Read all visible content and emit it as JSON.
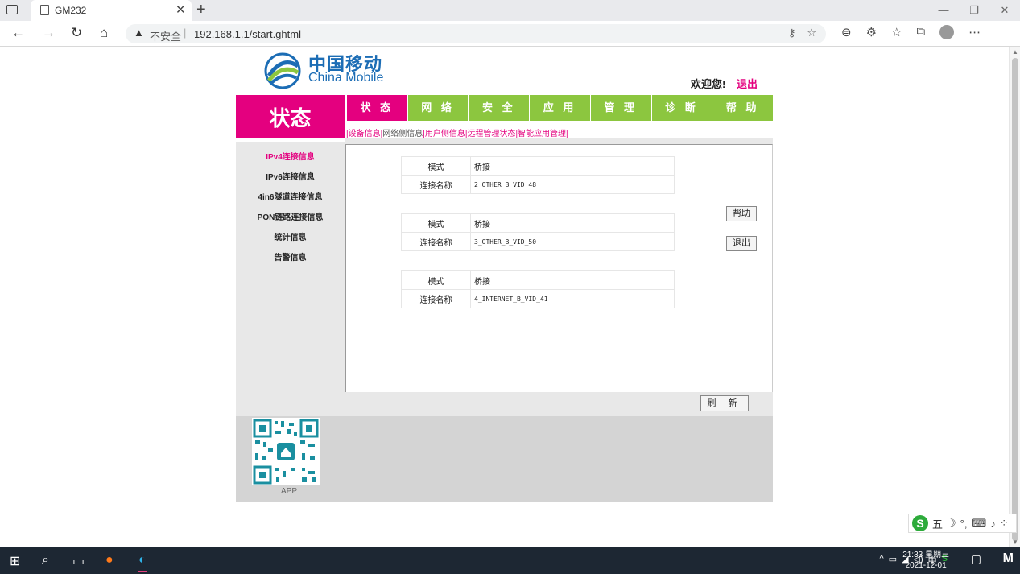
{
  "browser": {
    "tab_title": "GM232",
    "close_glyph": "✕",
    "new_tab_glyph": "+",
    "url_warning": "不安全",
    "url": "192.168.1.1/start.ghtml"
  },
  "header": {
    "logo_cn": "中国移动",
    "logo_en": "China Mobile",
    "welcome": "欢迎您!",
    "logout": "退出"
  },
  "section_title": "状态",
  "nav": [
    "状 态",
    "网 络",
    "安 全",
    "应 用",
    "管 理",
    "诊 断",
    "帮 助"
  ],
  "subnav": [
    "设备信息",
    "网络侧信息",
    "用户侧信息",
    "远程管理状态",
    "智能应用管理"
  ],
  "leftnav": [
    "IPv4连接信息",
    "IPv6连接信息",
    "4in6隧道连接信息",
    "PON链路连接信息",
    "统计信息",
    "告警信息"
  ],
  "connections": [
    {
      "mode_label": "模式",
      "mode": "桥接",
      "name_label": "连接名称",
      "name": "2_OTHER_B_VID_48"
    },
    {
      "mode_label": "模式",
      "mode": "桥接",
      "name_label": "连接名称",
      "name": "3_OTHER_B_VID_50"
    },
    {
      "mode_label": "模式",
      "mode": "桥接",
      "name_label": "连接名称",
      "name": "4_INTERNET_B_VID_41"
    }
  ],
  "buttons": {
    "help": "帮助",
    "logout": "退出",
    "refresh": "刷 新"
  },
  "footer": {
    "app_label": "APP"
  },
  "ime": {
    "mode": "五"
  },
  "taskbar": {
    "time": "21:33 星期三",
    "date": "2021-12-01",
    "lang": "中"
  }
}
